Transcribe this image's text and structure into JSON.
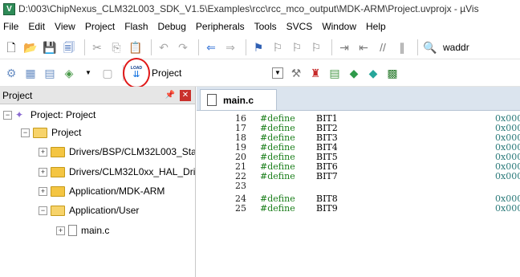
{
  "titlebar": {
    "title": "D:\\003\\ChipNexus_CLM32L003_SDK_V1.5\\Examples\\rcc\\rcc_mco_output\\MDK-ARM\\Project.uvprojx - µVis"
  },
  "menu": [
    "File",
    "Edit",
    "View",
    "Project",
    "Flash",
    "Debug",
    "Peripherals",
    "Tools",
    "SVCS",
    "Window",
    "Help"
  ],
  "toolbar1": {
    "find_text": "waddr"
  },
  "toolbar2": {
    "load_icon_text": "LOAD",
    "target_name": "Project"
  },
  "project_panel": {
    "title": "Project",
    "tree": [
      {
        "label": "Project: Project",
        "depth": 0,
        "expander": "-",
        "icon": "project-icon"
      },
      {
        "label": "Project",
        "depth": 1,
        "expander": "-",
        "icon": "folder-open-icon"
      },
      {
        "label": "Drivers/BSP/CLM32L003_Star",
        "depth": 2,
        "expander": "+",
        "icon": "folder-icon"
      },
      {
        "label": "Drivers/CLM32L0xx_HAL_Dri",
        "depth": 2,
        "expander": "+",
        "icon": "folder-icon"
      },
      {
        "label": "Application/MDK-ARM",
        "depth": 2,
        "expander": "+",
        "icon": "folder-icon"
      },
      {
        "label": "Application/User",
        "depth": 2,
        "expander": "-",
        "icon": "folder-open-icon"
      },
      {
        "label": "main.c",
        "depth": 3,
        "expander": "+",
        "icon": "file-icon"
      }
    ]
  },
  "editor": {
    "tab_label": "main.c",
    "lines": [
      {
        "ln": "16",
        "kw": "#define",
        "name": "BIT1",
        "val": "0x000"
      },
      {
        "ln": "17",
        "kw": "#define",
        "name": "BIT2",
        "val": "0x000"
      },
      {
        "ln": "18",
        "kw": "#define",
        "name": "BIT3",
        "val": "0x000"
      },
      {
        "ln": "19",
        "kw": "#define",
        "name": "BIT4",
        "val": "0x000"
      },
      {
        "ln": "20",
        "kw": "#define",
        "name": "BIT5",
        "val": "0x000"
      },
      {
        "ln": "21",
        "kw": "#define",
        "name": "BIT6",
        "val": "0x000"
      },
      {
        "ln": "22",
        "kw": "#define",
        "name": "BIT7",
        "val": "0x000"
      },
      {
        "ln": "23",
        "kw": "",
        "name": "",
        "val": ""
      },
      {
        "ln": "24",
        "kw": "#define",
        "name": "BIT8",
        "val": "0x000"
      },
      {
        "ln": "25",
        "kw": "#define",
        "name": "BIT9",
        "val": "0x000"
      }
    ]
  },
  "colors": {
    "annotation_circle": "#e01818",
    "keyword": "#1a7e1a",
    "value": "#2b7a7a",
    "tab_strip": "#dbe4ee"
  }
}
